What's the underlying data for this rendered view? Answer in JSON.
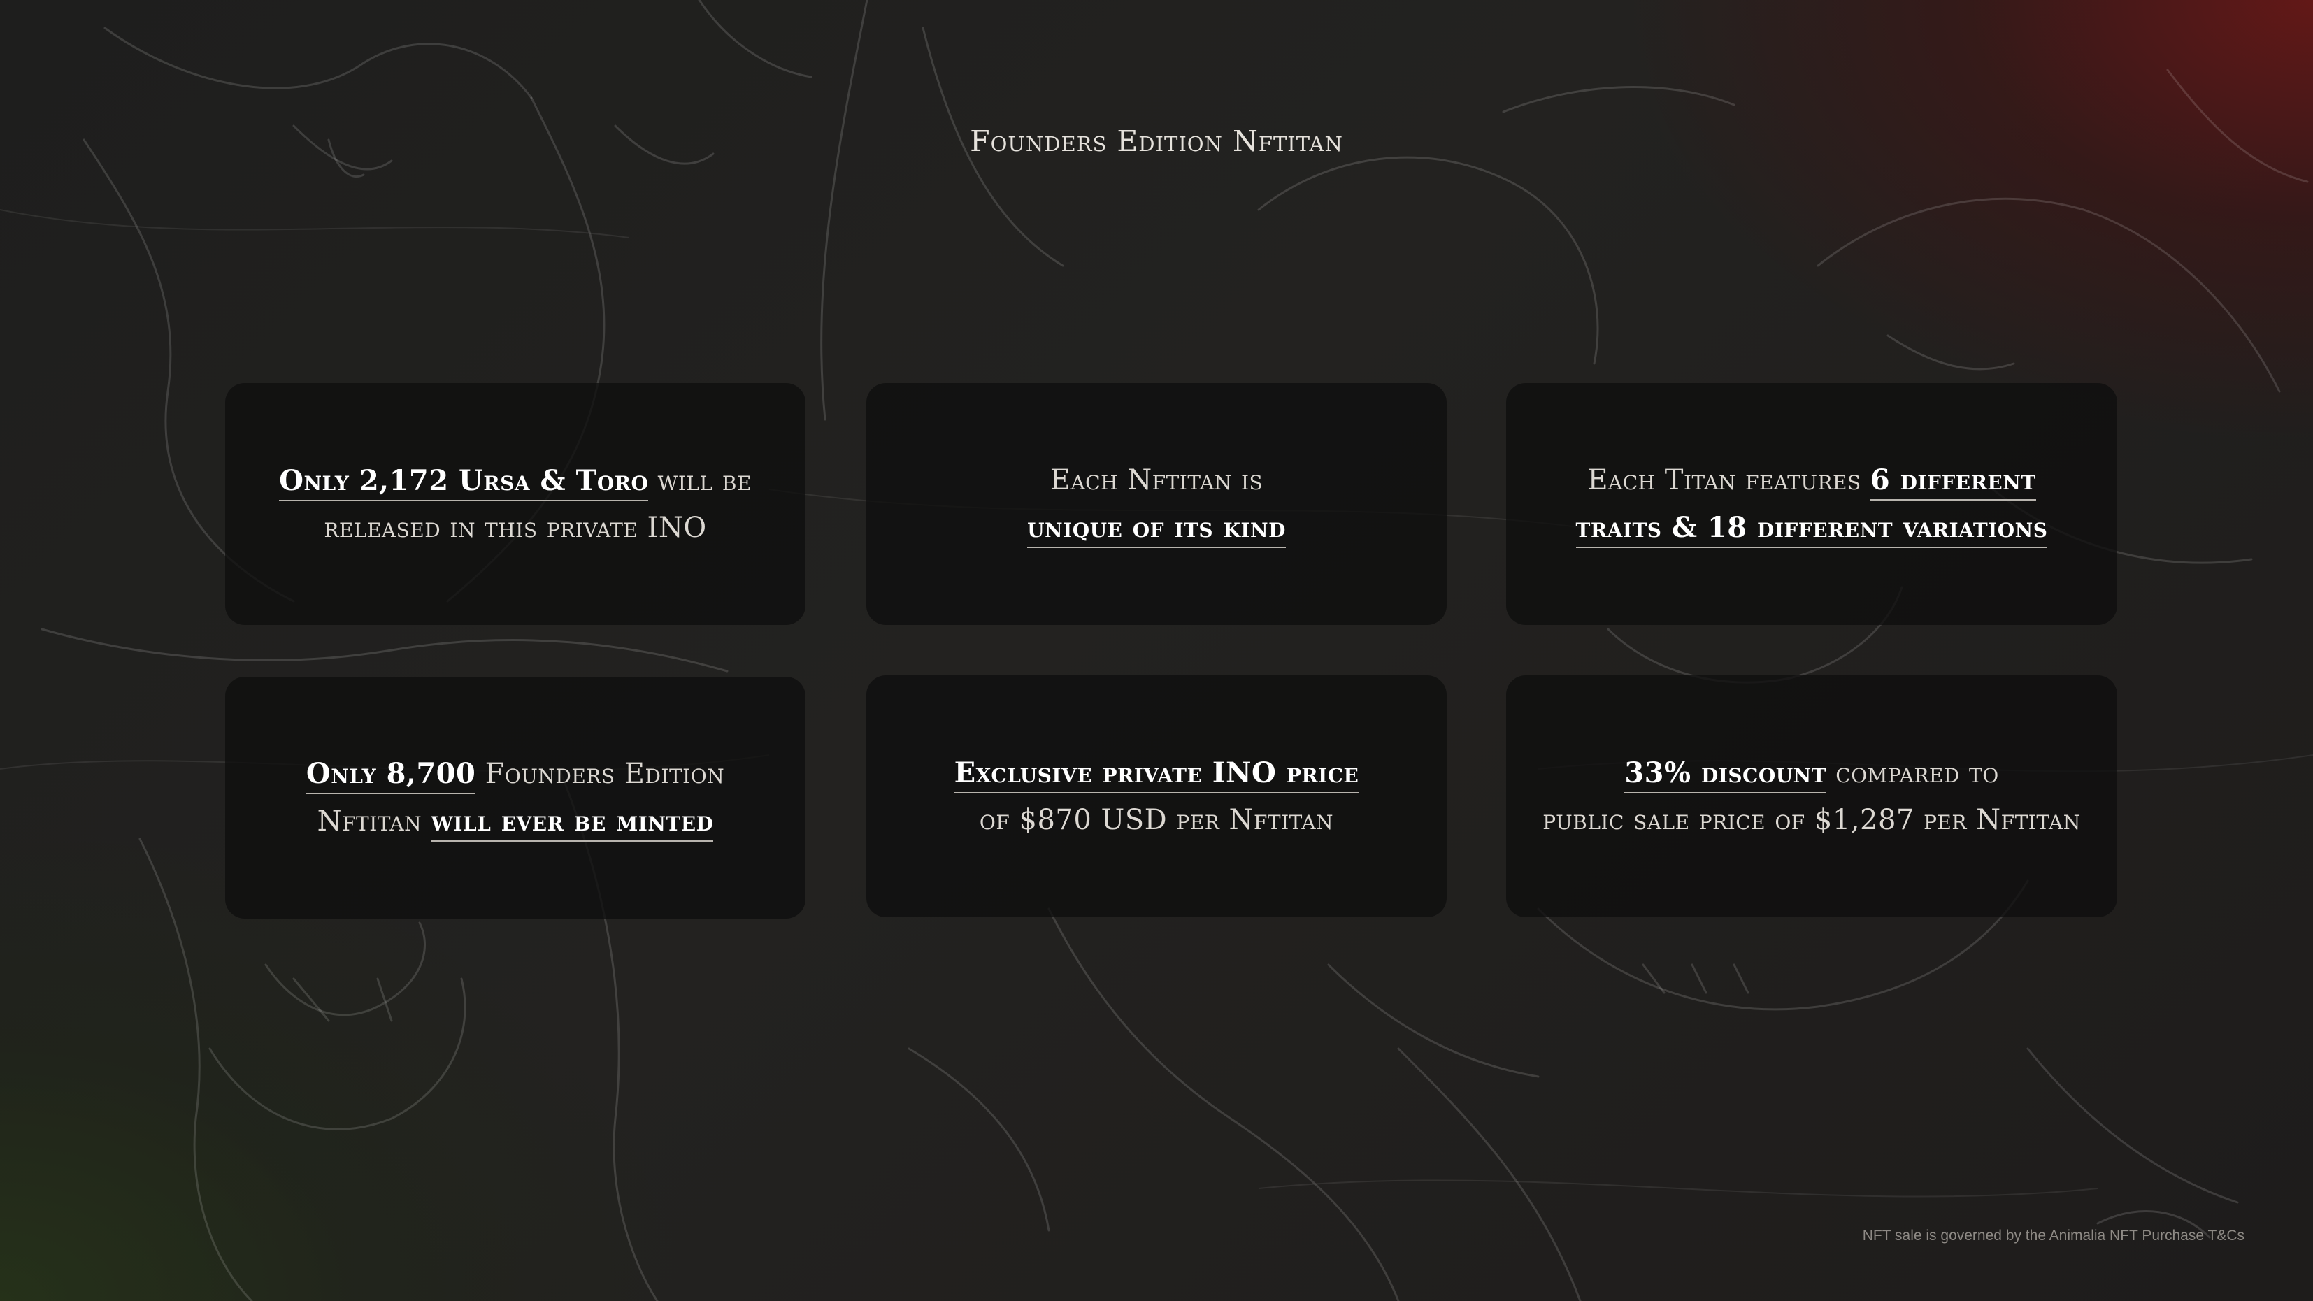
{
  "page": {
    "title": "Founders Edition Nftitan",
    "footnote": "NFT sale is governed by the Animalia NFT Purchase T&Cs"
  },
  "cards": [
    {
      "line1_hl": "Only 2,172 Ursa & Toro",
      "line1_rest": " will be",
      "line2": "released in this private INO"
    },
    {
      "line1": "Each Nftitan is",
      "line2_hl": "unique of its kind"
    },
    {
      "line1_pre": "Each Titan features ",
      "line1_hl": "6 different",
      "line2_hl": "traits & 18 different variations"
    },
    {
      "line1_hl": "Only 8,700",
      "line1_rest": " Founders Edition",
      "line2_pre": "Nftitan ",
      "line2_hl": "will ever be minted"
    },
    {
      "line1_hl": "Exclusive private INO price",
      "line2": "of $870 USD per Nftitan"
    },
    {
      "line1_hl": "33% discount",
      "line1_rest": " compared to",
      "line2": "public sale price of $1,287 per Nftitan"
    }
  ],
  "colors": {
    "background": "#1f1e1d",
    "accent_red": "#6e1616",
    "accent_green": "#263418",
    "card_bg": "#0e0e0e",
    "text": "#e8e4de"
  }
}
